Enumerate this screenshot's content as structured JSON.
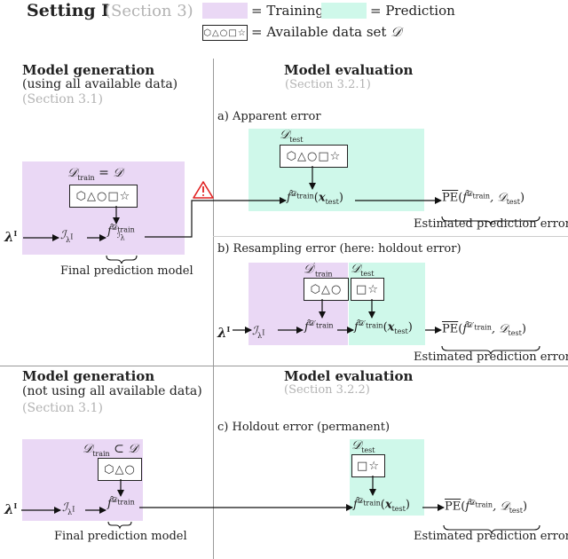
{
  "header": {
    "title": "Setting I",
    "section_ref": "(Section 3)",
    "legend": {
      "training_label": "= Training",
      "prediction_label": "= Prediction",
      "dataset_label": "= Available data set",
      "dataset_symbol": "𝒟",
      "dataset_shapes": "⬡△○□☆"
    },
    "colors": {
      "training": "#ead8f5",
      "prediction": "#cff8ea",
      "warning": "#e02020"
    }
  },
  "top": {
    "generation": {
      "title": "Model generation",
      "subtitle": "(using all available data)",
      "section": "(Section 3.1)",
      "dataset_label": "𝒟train = 𝒟",
      "dataset_shapes": "⬡△○□☆",
      "lambda": "λI",
      "inducer": "ℐλI",
      "model": "f̂ 𝒟train ℐλI",
      "caption": "Final prediction model",
      "warning_icon": "warning-triangle-icon"
    },
    "evaluation": {
      "title": "Model evaluation",
      "section": "(Section 3.2.1)",
      "a": {
        "label": "a) Apparent error",
        "dataset_label": "𝒟test",
        "dataset_shapes": "⬡△○□☆",
        "prediction": "f̂ 𝒟train ℐλI (xtest)",
        "pe": "PE(f̂ 𝒟train ℐλI , 𝒟test)",
        "caption": "Estimated prediction error"
      },
      "b": {
        "label": "b) Resampling error (here: holdout error)",
        "train_dataset_label": "𝒟′train",
        "train_shapes": "⬡△○",
        "test_dataset_label": "𝒟test",
        "test_shapes": "□☆",
        "lambda": "λI",
        "inducer": "ℐλI",
        "model": "f̂ 𝒟′train ℐλI",
        "prediction": "f̂ 𝒟′train ℐλI (xtest)",
        "pe": "PE(f̂ 𝒟′train ℐλI , 𝒟test)",
        "caption": "Estimated prediction error"
      }
    }
  },
  "bottom": {
    "generation": {
      "title": "Model generation",
      "subtitle": "(not using all available data)",
      "section": "(Section 3.1)",
      "dataset_label": "𝒟train ⊂ 𝒟",
      "dataset_shapes": "⬡△○",
      "lambda": "λI",
      "inducer": "ℐλI",
      "model": "f̂ 𝒟train ℐλI",
      "caption": "Final prediction model"
    },
    "evaluation": {
      "title": "Model evaluation",
      "section": "(Section 3.2.2)",
      "c": {
        "label": "c) Holdout error (permanent)",
        "dataset_label": "𝒟test",
        "dataset_shapes": "□☆",
        "prediction": "f̂ 𝒟train ℐλI (xtest)",
        "pe": "PE(f̂ 𝒟train ℐλI , 𝒟test)",
        "caption": "Estimated prediction error"
      }
    }
  },
  "math": {
    "D": "𝒟",
    "train": "train",
    "test": "test",
    "prime": "′",
    "lambda": "λ",
    "I": "I",
    "inducer": "ℐ",
    "f": "f̂",
    "x": "x",
    "pe": "PE",
    "subset": "⊂",
    "equals": "="
  }
}
